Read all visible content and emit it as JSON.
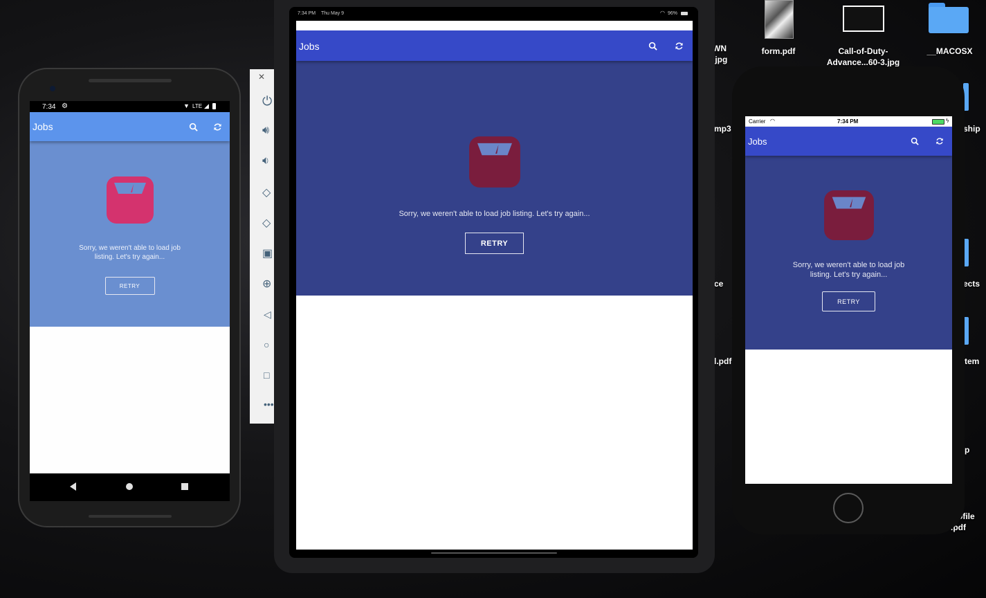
{
  "desktop": {
    "icons": [
      {
        "label": "form.pdf"
      },
      {
        "label": "Call-of-Duty-Advance...60-3.jpg"
      },
      {
        "label": "__MACOSX"
      }
    ],
    "partial_labels": [
      "WN",
      ".jpg",
      "mp3",
      "ship",
      "ce",
      "ects",
      "l.pdf",
      "tem",
      "p",
      "ofile",
      ".pdf"
    ]
  },
  "android": {
    "status": {
      "time": "7:34",
      "network": "LTE"
    },
    "appbar": {
      "title": "Jobs"
    },
    "message": "Sorry, we weren't able to load job listing. Let's try again...",
    "retry_label": "RETRY",
    "colors": {
      "appbar": "#5c94ec",
      "content": "#6a8fd0",
      "icon": "#d4336e"
    }
  },
  "tablet": {
    "status": {
      "time": "7:34 PM",
      "date": "Thu May 9",
      "battery": "96%"
    },
    "appbar": {
      "title": "Jobs"
    },
    "message": "Sorry, we weren't able to load job listing. Let's try again...",
    "retry_label": "RETRY",
    "colors": {
      "appbar": "#3649c8",
      "content": "#34418a",
      "icon": "#7a1d3d"
    }
  },
  "iphone": {
    "status": {
      "carrier": "Carrier",
      "time": "7:34 PM"
    },
    "appbar": {
      "title": "Jobs"
    },
    "message": "Sorry, we weren't able to load job listing. Let's try again...",
    "retry_label": "RETRY",
    "colors": {
      "appbar": "#3649c8",
      "content": "#34418a",
      "icon": "#7a1d3d"
    }
  },
  "emulator_toolbar": {
    "buttons": [
      "close-icon",
      "power-icon",
      "volume-up-icon",
      "volume-down-icon",
      "rotate-left-icon",
      "rotate-right-icon",
      "camera-icon",
      "zoom-icon",
      "back-icon",
      "home-icon",
      "overview-icon",
      "more-icon"
    ]
  }
}
